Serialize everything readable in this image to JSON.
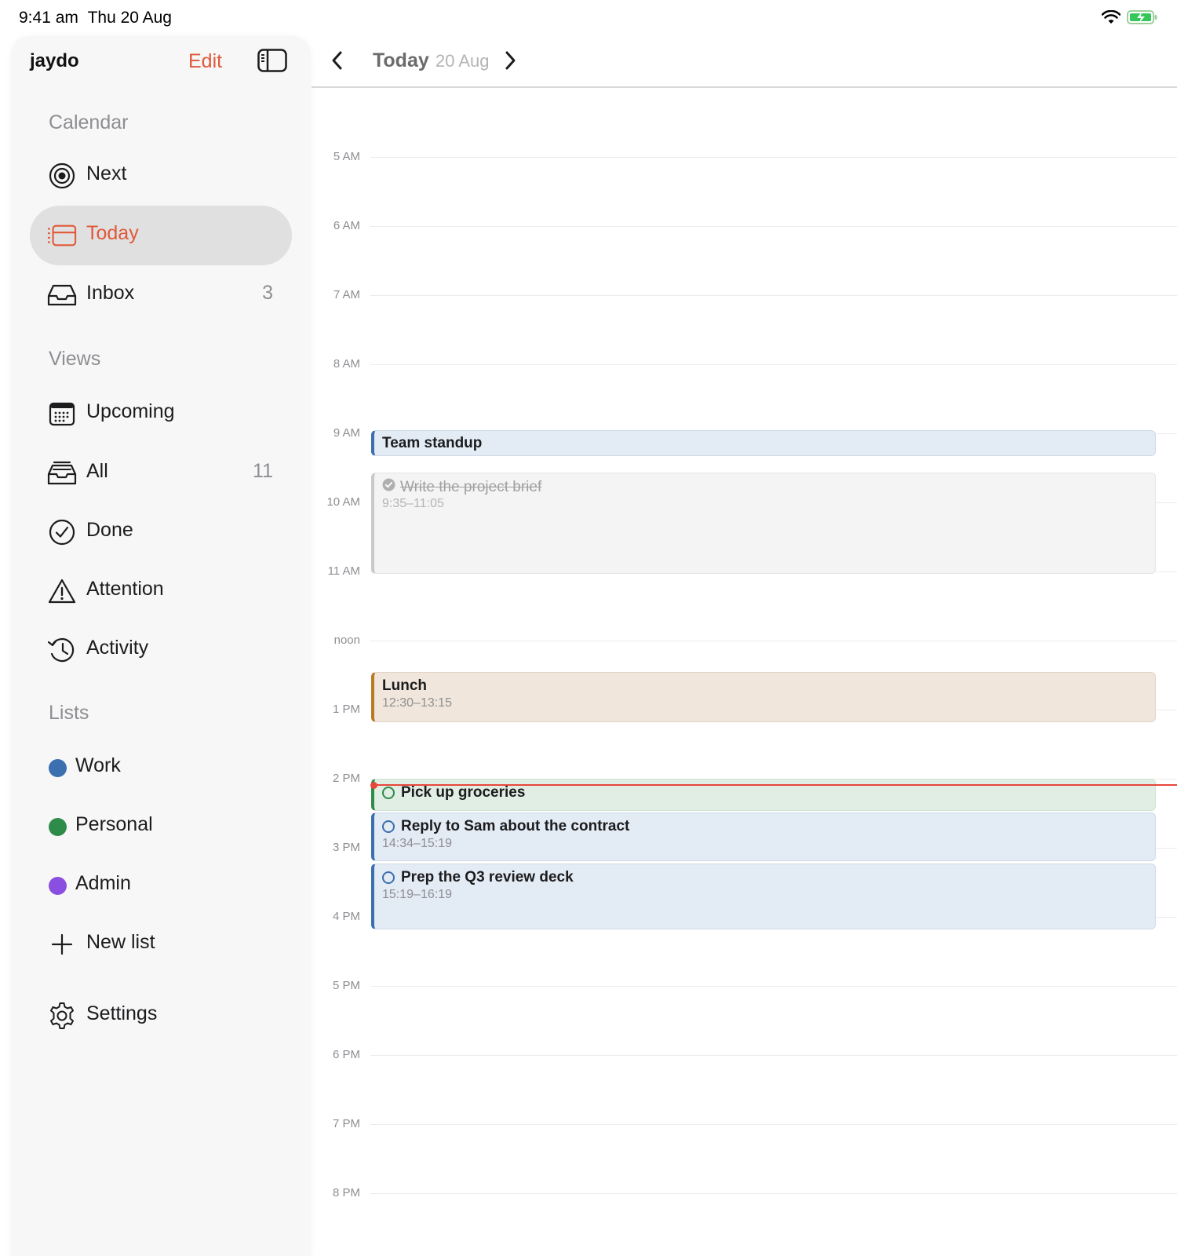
{
  "status_bar": {
    "time": "9:41 am",
    "date": "Thu 20 Aug"
  },
  "sidebar": {
    "app_name": "jaydo",
    "edit_label": "Edit",
    "sections": [
      {
        "title": "Calendar",
        "items": [
          {
            "label": "Next",
            "icon": "target-icon",
            "count": ""
          },
          {
            "label": "Today",
            "icon": "calendar-day-icon",
            "count": "",
            "active": true
          },
          {
            "label": "Inbox",
            "icon": "inbox-tray-icon",
            "count": "3"
          }
        ]
      },
      {
        "title": "Views",
        "items": [
          {
            "label": "Upcoming",
            "icon": "calendar-grid-icon",
            "count": ""
          },
          {
            "label": "All",
            "icon": "archive-tray-icon",
            "count": "11"
          },
          {
            "label": "Done",
            "icon": "check-circle-icon",
            "count": ""
          },
          {
            "label": "Attention",
            "icon": "warning-triangle-icon",
            "count": ""
          },
          {
            "label": "Activity",
            "icon": "history-clock-icon",
            "count": ""
          }
        ]
      },
      {
        "title": "Lists",
        "lists": [
          {
            "label": "Work",
            "color": "#3b6fb0"
          },
          {
            "label": "Personal",
            "color": "#2e8b4a"
          },
          {
            "label": "Admin",
            "color": "#8a4fe0"
          }
        ],
        "new_list_label": "New list"
      }
    ],
    "settings_label": "Settings"
  },
  "main": {
    "header": {
      "title": "Today",
      "subtitle": "20 Aug"
    },
    "hours": [
      "5 AM",
      "6 AM",
      "7 AM",
      "8 AM",
      "9 AM",
      "10 AM",
      "11 AM",
      "noon",
      "1 PM",
      "2 PM",
      "3 PM",
      "4 PM",
      "5 PM",
      "6 PM",
      "7 PM",
      "8 PM"
    ],
    "events": [
      {
        "title": "Team standup",
        "time": "",
        "kind": "event",
        "color": "#3b6fb0",
        "bg": "#e3ebf4"
      },
      {
        "title": "Write the project brief",
        "time": "9:35–11:05",
        "kind": "task-done",
        "color": "#c9c9c9",
        "bg": "#f4f4f4"
      },
      {
        "title": "Lunch",
        "time": "12:30–13:15",
        "kind": "event",
        "color": "#b87a22",
        "bg": "#f0e6dc"
      },
      {
        "title": "Pick up groceries",
        "time": "",
        "kind": "task",
        "color": "#2e8b4a",
        "bg": "#e1eee3"
      },
      {
        "title": "Reply to Sam about the contract",
        "time": "14:34–15:19",
        "kind": "task",
        "color": "#3b6fb0",
        "bg": "#e3ebf4"
      },
      {
        "title": "Prep the Q3 review deck",
        "time": "15:19–16:19",
        "kind": "task",
        "color": "#3b6fb0",
        "bg": "#e3ebf4"
      }
    ],
    "now_indicator_color": "#e8463a"
  },
  "colors": {
    "accent": "#e0583a",
    "active_bg": "#e0e0e0"
  }
}
